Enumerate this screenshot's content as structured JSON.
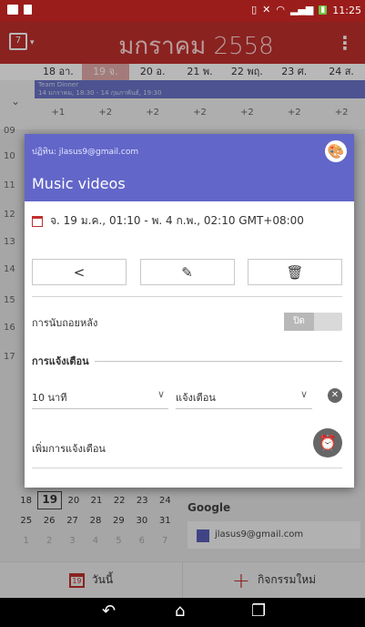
{
  "status": {
    "clock": "11:25"
  },
  "appbar": {
    "title": "มกราคม 2558",
    "calendar_icon_number": "7",
    "menu_glyph": "⋮"
  },
  "days": [
    "18 อา.",
    "19 จ.",
    "20 อ.",
    "21 พ.",
    "22 พฤ.",
    "23 ศ.",
    "24 ส."
  ],
  "allday": {
    "event_title": "Team Dinner",
    "event_time": "14 มกราคม, 18:30 - 14 กุมภาพันธ์, 19:30",
    "more_counts": [
      "+1",
      "+2",
      "+2",
      "+2",
      "+2",
      "+2",
      "+2"
    ]
  },
  "hours": [
    "09",
    "10",
    "11",
    "12",
    "13",
    "14",
    "15",
    "16",
    "17"
  ],
  "dialog": {
    "calendar": "ปฏิทิน: jlasus9@gmail.com",
    "title": "Music videos",
    "when": "จ. 19 ม.ค., 01:10 - พ. 4 ก.พ., 02:10  GMT+08:00",
    "countdown_label": "การนับถอยหลัง",
    "countdown_toggle": "ปิด",
    "reminders_header": "การแจ้งเตือน",
    "reminder_time": "10 นาที",
    "reminder_method": "แจ้งเตือน",
    "add_reminder": "เพิ่มการแจ้งเตือน"
  },
  "minical": {
    "rows": [
      [
        "18",
        "19",
        "20",
        "21",
        "22",
        "23",
        "24"
      ],
      [
        "25",
        "26",
        "27",
        "28",
        "29",
        "30",
        "31"
      ],
      [
        "1",
        "2",
        "3",
        "4",
        "5",
        "6",
        "7"
      ]
    ]
  },
  "calendars": {
    "header": "Google",
    "account": "jlasus9@gmail.com",
    "account_color": "#5a5fb8"
  },
  "actions": {
    "today": "วันนี้",
    "new_event": "กิจกรรมใหม่"
  },
  "colors": {
    "accent": "#c0302d",
    "event": "#6266c8"
  }
}
